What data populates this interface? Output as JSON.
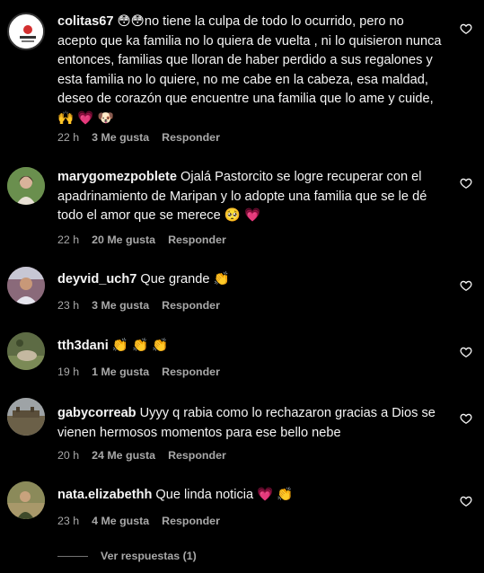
{
  "comments": [
    {
      "username": "colitas67",
      "text": "😳😳no tiene la culpa de todo lo ocurrido, pero no acepto que ka familia no lo quiera de vuelta , ni lo quisieron nunca entonces, familias que lloran de haber perdido a sus regalones y esta familia no lo quiere, no me cabe en la cabeza, esa maldad, deseo de corazón que encuentre una familia que lo ame y cuide,🙌 💗 🐶",
      "time": "22 h",
      "likes": "3 Me gusta",
      "reply": "Responder",
      "avatar_color": "#ffffff"
    },
    {
      "username": "marygomezpoblete",
      "text": "Ojalá Pastorcito se logre recuperar con el apadrinamiento de Maripan y lo adopte una familia que se le dé todo el amor que se merece 🥺 💗",
      "time": "22 h",
      "likes": "20 Me gusta",
      "reply": "Responder",
      "avatar_color": "#6a8f4e"
    },
    {
      "username": "deyvid_uch7",
      "text": "Que grande 👏",
      "time": "23 h",
      "likes": "3 Me gusta",
      "reply": "Responder",
      "avatar_color": "#8a6a7a"
    },
    {
      "username": "tth3dani",
      "text": "👏 👏 👏",
      "time": "19 h",
      "likes": "1 Me gusta",
      "reply": "Responder",
      "avatar_color": "#5d6b44"
    },
    {
      "username": "gabycorreab",
      "text": "Uyyy q rabia como lo rechazaron gracias a Dios se vienen hermosos momentos para ese bello nebe",
      "time": "20 h",
      "likes": "24 Me gusta",
      "reply": "Responder",
      "avatar_color": "#7d7a6e"
    },
    {
      "username": "nata.elizabethh",
      "text": "Que linda noticia 💗 👏",
      "time": "23 h",
      "likes": "4 Me gusta",
      "reply": "Responder",
      "avatar_color": "#8b8a5a"
    }
  ],
  "more_replies": "Ver respuestas (1)",
  "colors": {
    "background": "#000000",
    "text": "#f5f5f5",
    "muted": "#a8a8a8"
  },
  "icons": {
    "like": "heart-outline-icon"
  }
}
